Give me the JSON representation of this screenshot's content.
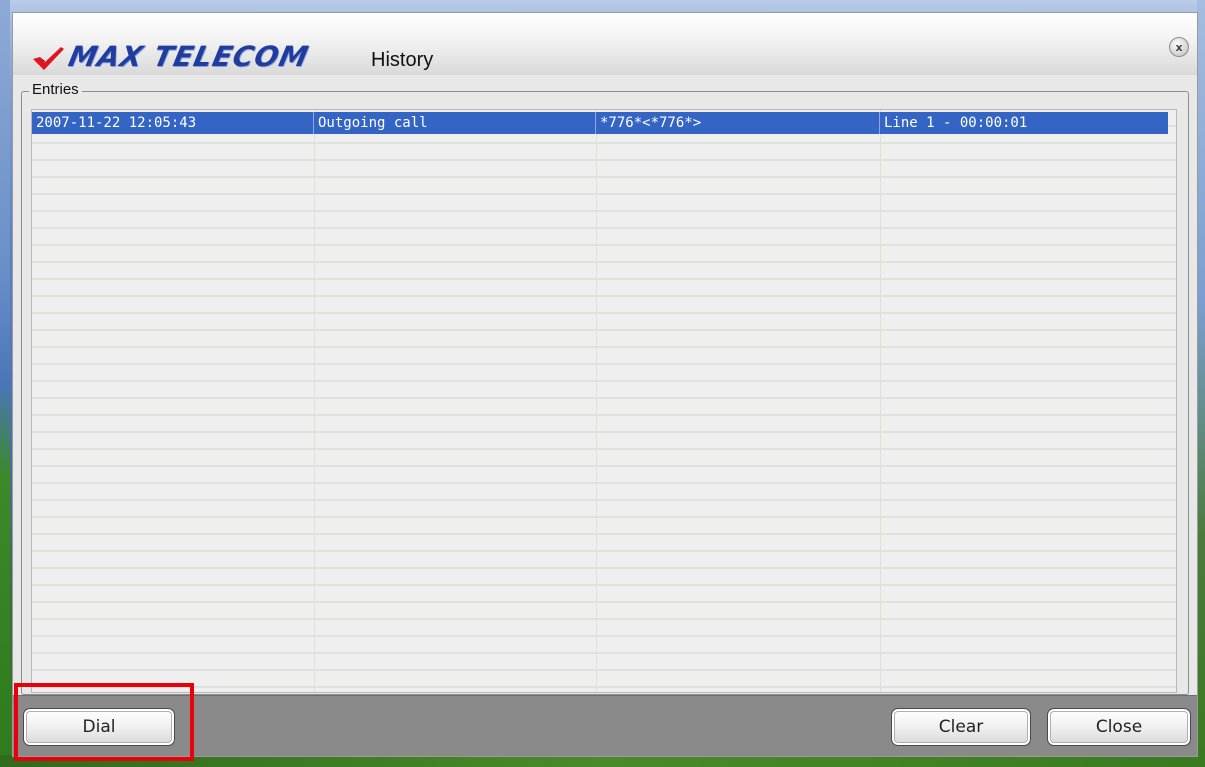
{
  "window": {
    "brand": "MAX TELECOM",
    "title": "History"
  },
  "entries": {
    "label": "Entries",
    "rows": [
      {
        "datetime": "2007-11-22 12:05:43",
        "type": "Outgoing call",
        "number": "*776*<*776*>",
        "line_duration": "Line 1 - 00:00:01",
        "selected": true
      }
    ]
  },
  "buttons": {
    "dial": "Dial",
    "clear": "Clear",
    "close": "Close",
    "window_close": "x"
  },
  "colors": {
    "brand_blue": "#1f3c9e",
    "brand_check_red": "#e0141e",
    "selection_blue": "#3565c4",
    "highlight_red": "#e8000b",
    "bottom_bar_gray": "#8a8a8a"
  },
  "icons": {
    "logo_check": "red-checkmark-icon",
    "window_close": "close-icon"
  }
}
